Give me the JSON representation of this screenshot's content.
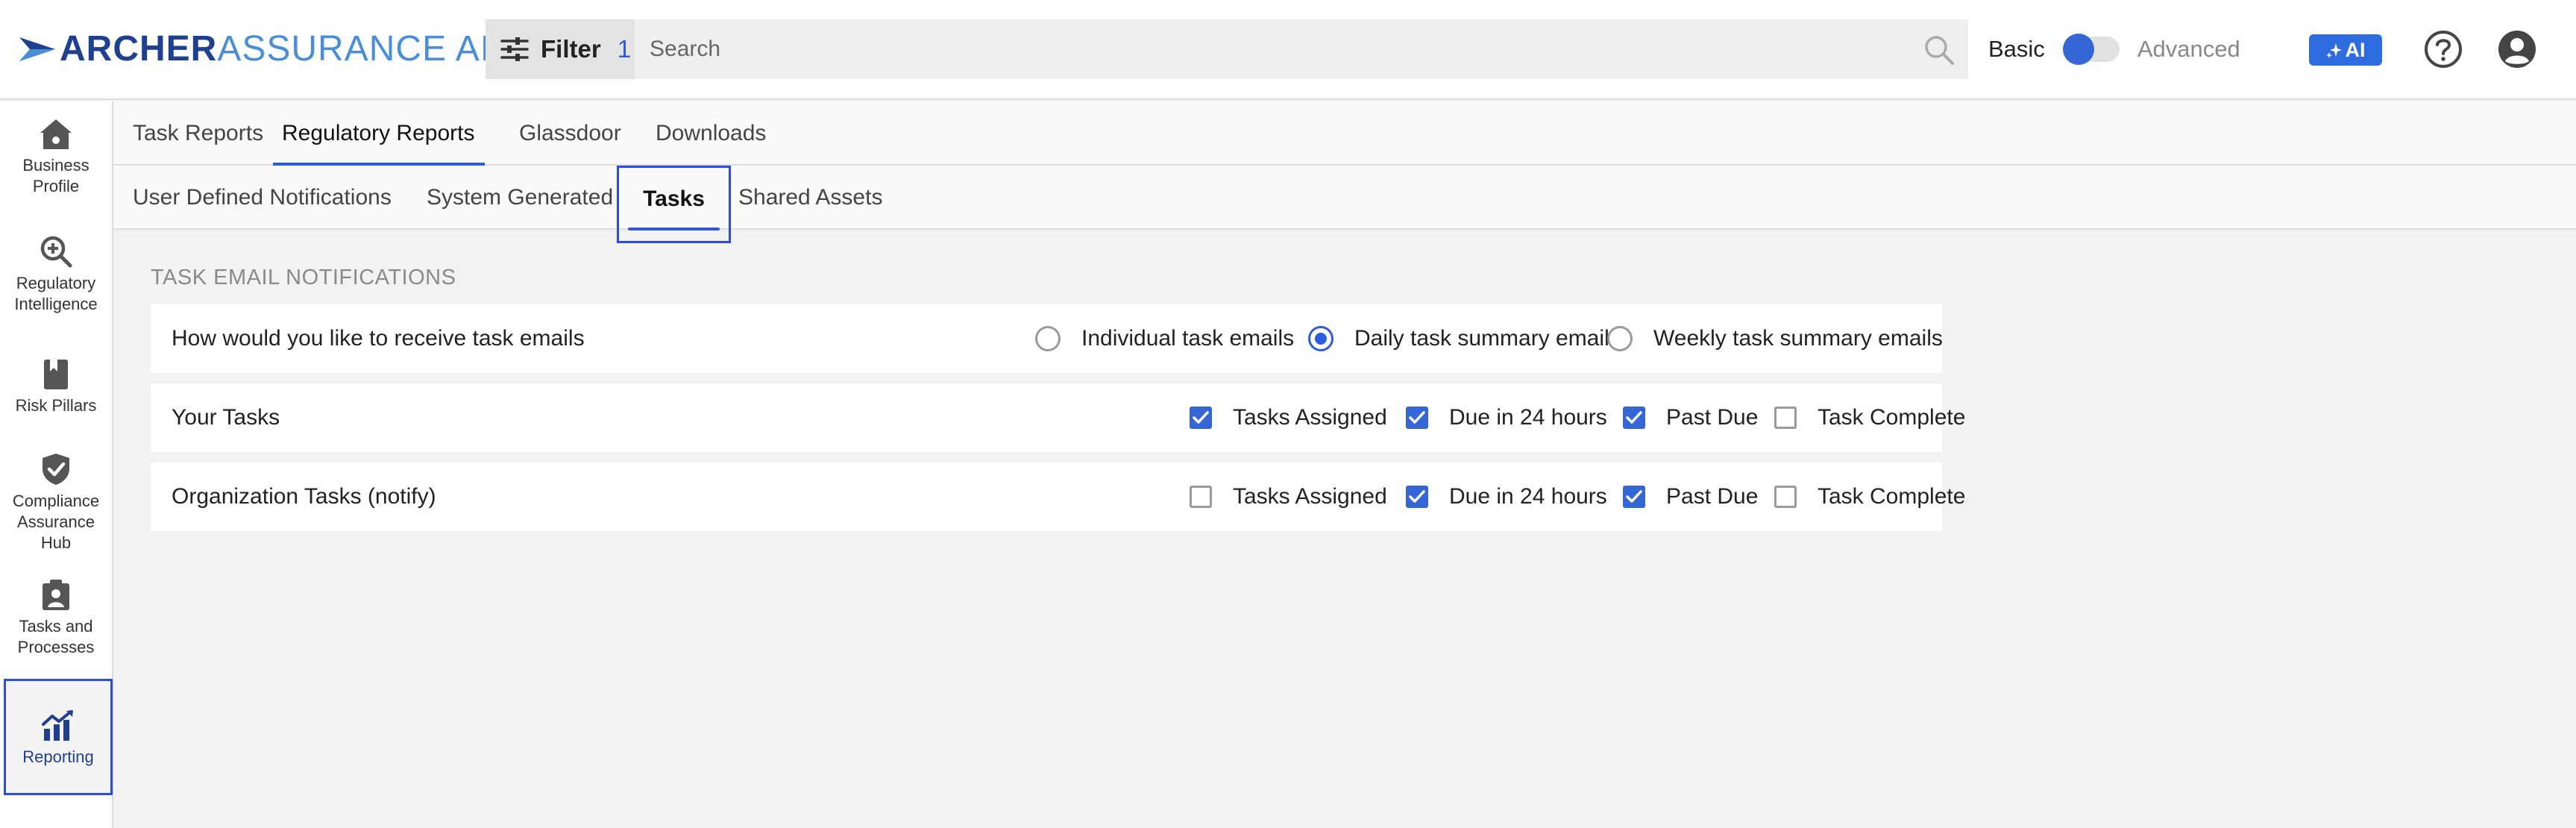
{
  "brand": {
    "logo_text_strong": "ARCHER",
    "logo_text_light": "ASSURANCE AI",
    "colors": {
      "primary": "#2d5bdf",
      "brand_dark": "#1f3f8f",
      "brand_light": "#4a8fd6",
      "focus_outline": "#2d4be0"
    }
  },
  "header": {
    "filter_icon": "sliders-icon",
    "filter_label": "Filter",
    "filter_count": "1",
    "search_placeholder": "Search",
    "search_icon": "search-icon",
    "mode_basic": "Basic",
    "mode_advanced": "Advanced",
    "mode_toggle_state": "basic",
    "ai_button": "AI",
    "ai_icon": "sparkle-icon",
    "help_icon": "help-circle-icon",
    "user_icon": "account-circle-icon"
  },
  "sidebar": {
    "items": [
      {
        "label": "Business\nProfile",
        "icon": "home-icon",
        "active": false
      },
      {
        "label": "Regulatory\nIntelligence",
        "icon": "magnify-plus-icon",
        "active": false
      },
      {
        "label": "Risk Pillars",
        "icon": "book-icon",
        "active": false
      },
      {
        "label": "Compliance\nAssurance\nHub",
        "icon": "shield-check-icon",
        "active": false
      },
      {
        "label": "Tasks and\nProcesses",
        "icon": "clipboard-person-icon",
        "active": false
      },
      {
        "label": "Reporting",
        "icon": "chart-icon",
        "active": true
      }
    ]
  },
  "tabs_primary": [
    {
      "label": "Task Reports",
      "active": false
    },
    {
      "label": "Regulatory Reports",
      "active": true
    },
    {
      "label": "Glassdoor",
      "active": false
    },
    {
      "label": "Downloads",
      "active": false
    }
  ],
  "tabs_secondary": [
    {
      "label": "User Defined Notifications",
      "active": false
    },
    {
      "label": "System Generated",
      "active": false
    },
    {
      "label": "Tasks",
      "active": true
    },
    {
      "label": "Shared Assets",
      "active": false
    }
  ],
  "content": {
    "section_title": "TASK EMAIL NOTIFICATIONS",
    "email_pref": {
      "question": "How would you like to receive task emails",
      "options": [
        {
          "label": "Individual task emails",
          "selected": false
        },
        {
          "label": "Daily task summary emails",
          "selected": true
        },
        {
          "label": "Weekly task summary emails",
          "selected": false
        }
      ]
    },
    "rows": [
      {
        "label": "Your Tasks",
        "checks": [
          {
            "label": "Tasks Assigned",
            "checked": true
          },
          {
            "label": "Due in 24 hours",
            "checked": true
          },
          {
            "label": "Past Due",
            "checked": true
          },
          {
            "label": "Task Complete",
            "checked": false
          }
        ]
      },
      {
        "label": "Organization Tasks (notify)",
        "checks": [
          {
            "label": "Tasks Assigned",
            "checked": false
          },
          {
            "label": "Due in 24 hours",
            "checked": true
          },
          {
            "label": "Past Due",
            "checked": true
          },
          {
            "label": "Task Complete",
            "checked": false
          }
        ]
      }
    ]
  }
}
